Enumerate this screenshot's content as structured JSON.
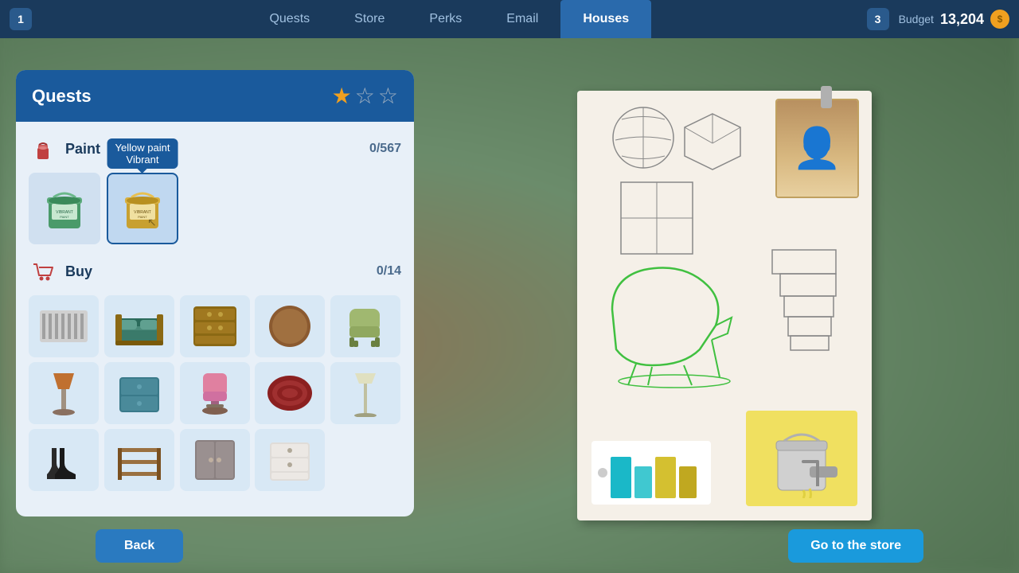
{
  "nav": {
    "badge_left": "1",
    "badge_right": "3",
    "tabs": [
      {
        "id": "quests",
        "label": "Quests",
        "active": false
      },
      {
        "id": "store",
        "label": "Store",
        "active": false
      },
      {
        "id": "perks",
        "label": "Perks",
        "active": false
      },
      {
        "id": "email",
        "label": "Email",
        "active": false
      },
      {
        "id": "houses",
        "label": "Houses",
        "active": true
      }
    ],
    "budget_label": "Budget",
    "budget_amount": "13,204"
  },
  "quests": {
    "title": "Quests",
    "stars_filled": 1,
    "stars_empty": 2,
    "sections": {
      "paint": {
        "name": "Paint",
        "count": "0/567",
        "tooltip_text": "Yellow paint",
        "tooltip_sub": "Vibrant",
        "items": [
          {
            "id": "paint1",
            "label": "Green paint",
            "selected": false
          },
          {
            "id": "paint2",
            "label": "Yellow paint Vibrant",
            "selected": true
          }
        ]
      },
      "buy": {
        "name": "Buy",
        "count": "0/14",
        "items": [
          {
            "id": "radiator",
            "label": "Radiator"
          },
          {
            "id": "bed",
            "label": "Bed"
          },
          {
            "id": "dresser",
            "label": "Dresser"
          },
          {
            "id": "round-table",
            "label": "Round Table"
          },
          {
            "id": "chair",
            "label": "Chair"
          },
          {
            "id": "lamp",
            "label": "Table Lamp"
          },
          {
            "id": "nightstand",
            "label": "Nightstand"
          },
          {
            "id": "office-chair",
            "label": "Office Chair"
          },
          {
            "id": "rug",
            "label": "Rug"
          },
          {
            "id": "floor-lamp",
            "label": "Floor Lamp"
          },
          {
            "id": "boots",
            "label": "Boots"
          },
          {
            "id": "shelf",
            "label": "Shelf"
          },
          {
            "id": "cabinet",
            "label": "Cabinet"
          },
          {
            "id": "white-dresser",
            "label": "White Dresser"
          }
        ]
      }
    }
  },
  "buttons": {
    "back": "Back",
    "go_to_store": "Go to the store"
  },
  "colors": {
    "nav_bg": "#1a3a5c",
    "card_header": "#1a5a9c",
    "card_body": "#e8f0f8",
    "btn_back": "#2a7ac0",
    "btn_store": "#1a9adc",
    "swatch1": "#1ab8c8",
    "swatch2": "#40c8d0",
    "swatch3": "#d4c030",
    "swatch4": "#c0a820",
    "yellow_bg": "#f0e060"
  }
}
